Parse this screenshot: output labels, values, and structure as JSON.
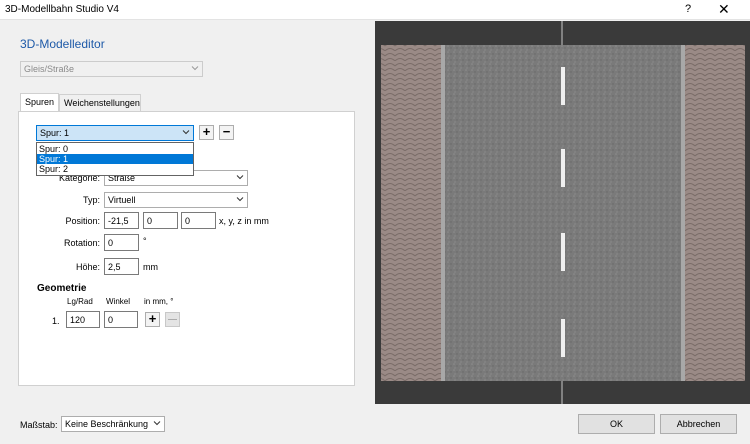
{
  "window": {
    "title": "3D-Modellbahn Studio V4",
    "help_label": "?",
    "close_label": "✕"
  },
  "editor": {
    "heading": "3D-Modelleditor",
    "type_select": {
      "value": "Gleis/Straße"
    }
  },
  "tabs": [
    {
      "label": "Spuren"
    },
    {
      "label": "Weichenstellungen"
    }
  ],
  "spur": {
    "selected": "Spur: 1",
    "add_label": "+",
    "remove_label": "−",
    "options": [
      "Spur: 0",
      "Spur: 1",
      "Spur: 2"
    ]
  },
  "form": {
    "kategorie_label": "Kategorie:",
    "kategorie_value": "Straße",
    "typ_label": "Typ:",
    "typ_value": "Virtuell",
    "position_label": "Position:",
    "position_x": "-21,5",
    "position_y": "0",
    "position_z": "0",
    "position_unit": "x, y, z in mm",
    "rotation_label": "Rotation:",
    "rotation_value": "0",
    "rotation_unit": "°",
    "hoehe_label": "Höhe:",
    "hoehe_value": "2,5",
    "hoehe_unit": "mm"
  },
  "geometrie": {
    "title": "Geometrie",
    "col_lg": "Lg/Rad",
    "col_winkel": "Winkel",
    "col_unit": "in mm, °",
    "row_index": "1.",
    "row_lg": "120",
    "row_winkel": "0",
    "add_label": "+",
    "remove_label": "—"
  },
  "footer": {
    "massstab_label": "Maßstab:",
    "massstab_value": "Keine Beschränkung",
    "ok_label": "OK",
    "cancel_label": "Abbrechen"
  }
}
